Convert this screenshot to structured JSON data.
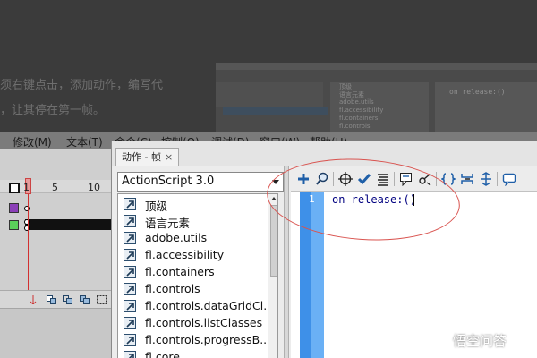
{
  "article": {
    "line1": "须右键点击，添加动作，编写代",
    "line2": "，让其停在第一帧。",
    "thumbnail": {
      "list": [
        "顶级",
        "语言元素",
        "adobe.utils",
        "fl.accessibility",
        "fl.containers",
        "fl.controls"
      ],
      "code": "on release:()"
    }
  },
  "menubar": {
    "items": [
      "修改(M)",
      "文本(T)",
      "命令(C)",
      "控制(O)",
      "调试(D)",
      "窗口(W)",
      "帮助(H)"
    ]
  },
  "timeline": {
    "frame_numbers": [
      "1",
      "5",
      "10"
    ],
    "layer_colors": [
      "#8b3fb8",
      "#5ad15a"
    ]
  },
  "actions_panel": {
    "tab_label": "动作 - 帧",
    "tab_close": "×",
    "language": "ActionScript 3.0",
    "list_items": [
      "顶级",
      "语言元素",
      "adobe.utils",
      "fl.accessibility",
      "fl.containers",
      "fl.controls",
      "fl.controls.dataGridCl...",
      "fl.controls.listClasses",
      "fl.controls.progressB...",
      "fl.core"
    ],
    "toolbar_icons": [
      "add-statement-icon",
      "find-icon",
      "target-path-icon",
      "check-syntax-icon",
      "auto-format-icon",
      "code-hint-icon",
      "debug-options-icon",
      "collapse-between-braces-icon",
      "collapse-selection-icon",
      "expand-all-icon",
      "apply-block-comment-icon"
    ],
    "editor": {
      "line_number": "1",
      "code": "on release:()"
    }
  },
  "watermark": {
    "text": "悟空问答"
  },
  "colors": {
    "annotation": "#d9534f",
    "gutter": "#3e90e8",
    "code_text": "#000080"
  }
}
